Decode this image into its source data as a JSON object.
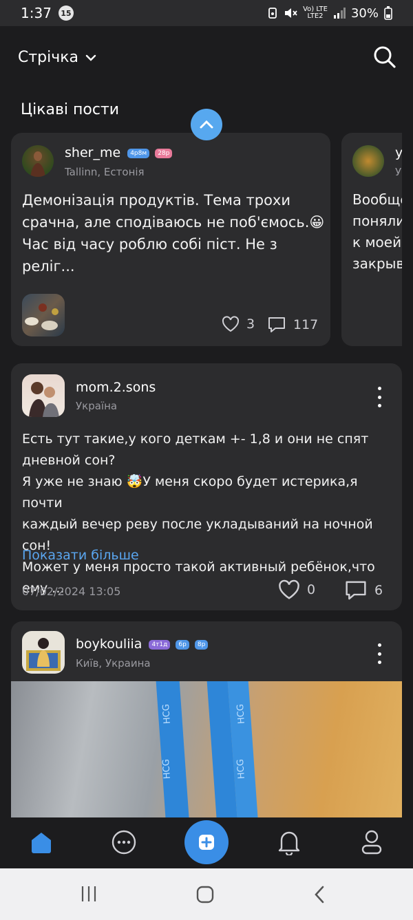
{
  "status_bar": {
    "time": "1:37",
    "notif_count": "15",
    "battery": "30%",
    "net_top": "Vo) LTE",
    "net_bottom": "LTE2"
  },
  "header": {
    "title": "Стрічка",
    "section_title": "Цікаві пости"
  },
  "featured": [
    {
      "username": "sher_me",
      "badges": [
        "4р8м",
        "28р"
      ],
      "location": "Tallinn, Естонія",
      "text_lines": [
        "Демонізація продуктів. Тема трохи",
        "срачна, але сподіваюсь не поб'ємось.😀",
        "Час від часу роблю собі піст. Не з реліг..."
      ],
      "likes": "3",
      "comments": "117"
    },
    {
      "username": "y",
      "location": "У",
      "text_lines": [
        "Вообще",
        "поняли",
        "к моей",
        "закрыв"
      ]
    }
  ],
  "posts": [
    {
      "username": "mom.2.sons",
      "location": "Україна",
      "text_lines": [
        "Есть тут такие,у кого деткам +- 1,8 и они не спят",
        "дневной сон?",
        "Я уже не знаю 🤯У меня скоро будет истерика,я почти",
        "каждый вечер реву после укладываний на ночной сон!",
        "Может у меня просто такой активный ребёнок,что ему ..."
      ],
      "more_label": "Показати більше",
      "date": "07/02/2024 13:05",
      "likes": "0",
      "comments": "6"
    },
    {
      "username": "boykouliia",
      "badges": [
        "4т1д",
        "6р",
        "8р"
      ],
      "location": "Київ, Украина",
      "image_text": [
        "HCG",
        "HCG",
        "HCG",
        "HCG"
      ]
    }
  ],
  "nav": {
    "items": [
      "home-icon",
      "chat-icon",
      "add-icon",
      "bell-icon",
      "profile-icon"
    ]
  },
  "colors": {
    "accent": "#3a8ee6",
    "card": "#2c2c2e",
    "background": "#1c1c1e",
    "link": "#5aa6f0"
  }
}
